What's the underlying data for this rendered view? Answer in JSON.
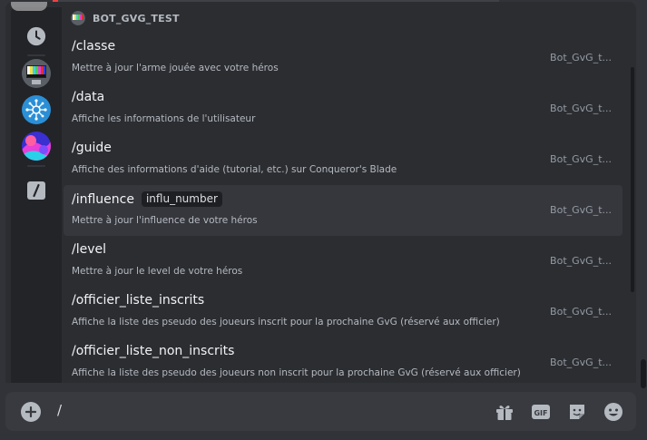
{
  "section": {
    "bot_name": "BOT_GVG_TEST"
  },
  "rail": {
    "items": [
      {
        "icon": "clock-icon"
      },
      {
        "icon": "bot-avatar-tv"
      },
      {
        "icon": "bot-avatar-network"
      },
      {
        "icon": "bot-avatar-colorful"
      },
      {
        "icon": "slash-command-icon"
      }
    ]
  },
  "commands": [
    {
      "name": "/classe",
      "option": "",
      "description": "Mettre à jour l'arme jouée avec votre héros",
      "source": "Bot_GvG_t..."
    },
    {
      "name": "/data",
      "option": "",
      "description": "Affiche les informations de l'utilisateur",
      "source": "Bot_GvG_t..."
    },
    {
      "name": "/guide",
      "option": "",
      "description": "Affiche des informations d'aide (tutorial, etc.) sur Conqueror's Blade",
      "source": "Bot_GvG_t..."
    },
    {
      "name": "/influence",
      "option": "influ_number",
      "description": "Mettre à jour l'influence de votre héros",
      "source": "Bot_GvG_t..."
    },
    {
      "name": "/level",
      "option": "",
      "description": "Mettre à jour le level de votre héros",
      "source": "Bot_GvG_t..."
    },
    {
      "name": "/officier_liste_inscrits",
      "option": "",
      "description": "Affiche la liste des pseudo des joueurs inscrit pour la prochaine GvG (réservé aux officier)",
      "source": "Bot_GvG_t..."
    },
    {
      "name": "/officier_liste_non_inscrits",
      "option": "",
      "description": "Affiche la liste des pseudo des joueurs non inscrit pour la prochaine GvG (réservé aux officier)",
      "source": "Bot_GvG_t..."
    }
  ],
  "selected_command": "/influence",
  "composer": {
    "value": "/",
    "tools": [
      "gift-icon",
      "gif-icon",
      "sticker-icon",
      "emoji-icon"
    ]
  }
}
